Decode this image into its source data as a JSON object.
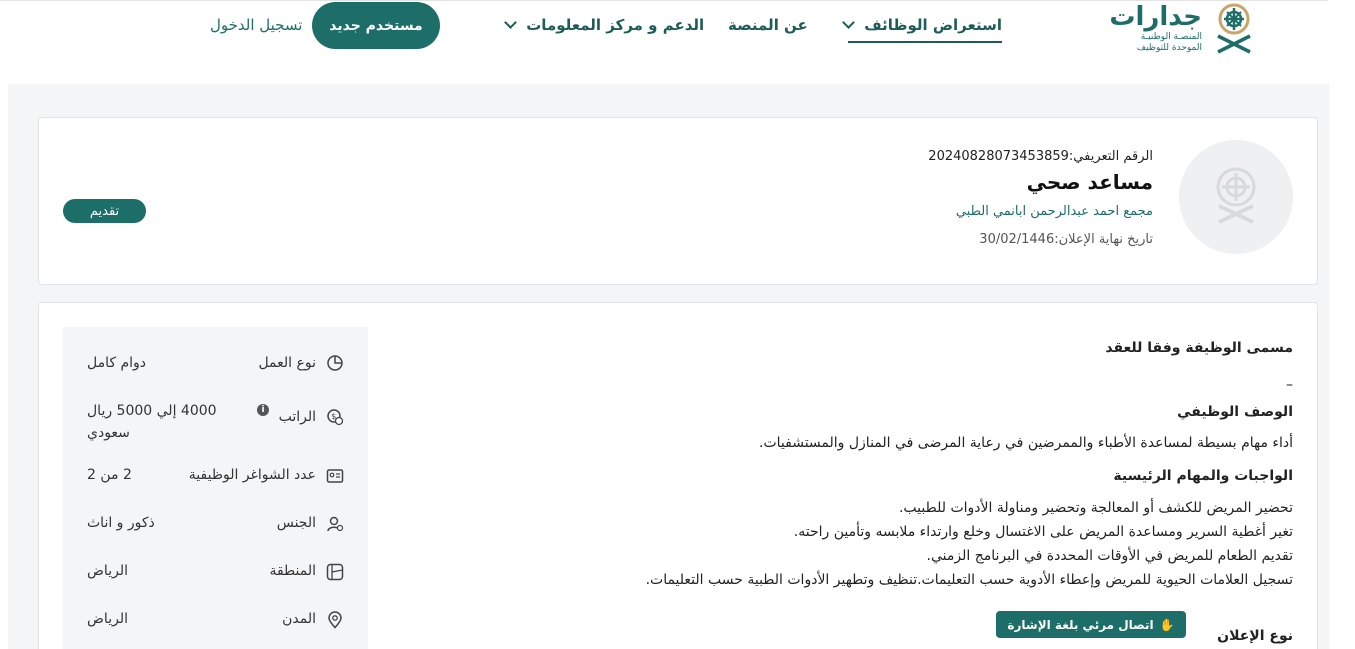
{
  "header": {
    "logo_word": "جدارات",
    "logo_sub_1": "المنصـة الوطنيـة",
    "logo_sub_2": "الموحدة للتوظيف",
    "nav": {
      "jobs": "استعراض الوظائف",
      "about": "عن المنصة",
      "support": "الدعم و مركز المعلومات"
    },
    "register_label": "مستخدم جديد",
    "login_label": "تسجيل الدخول"
  },
  "job": {
    "id_label": "الرقم التعريفي:",
    "id_value": "20240828073453859",
    "title": "مساعد صحي",
    "company": "مجمع احمد عبدالرحمن ابانمي الطبي",
    "deadline_label": "تاريخ نهاية الإعلان:",
    "deadline_value": "30/02/1446",
    "apply_label": "تقديم"
  },
  "details": {
    "work_type": {
      "label": "نوع العمل",
      "value": "دوام كامل",
      "icon": "pie-chart-icon"
    },
    "salary": {
      "label": "الراتب",
      "value": "4000 إلي 5000 ريال سعودي",
      "icon": "money-icon"
    },
    "vacancies": {
      "label": "عدد الشواغر الوظيفية",
      "value": "2  من 2",
      "icon": "id-card-icon"
    },
    "gender": {
      "label": "الجنس",
      "value": "ذكور و اناث",
      "icon": "person-icon"
    },
    "region": {
      "label": "المنطقة",
      "value": "الرياض",
      "icon": "map-icon"
    },
    "city": {
      "label": "المدن",
      "value": "الرياض",
      "icon": "location-pin-icon"
    }
  },
  "description": {
    "contract_title_heading": "مسمى الوظيفة وفقا للعقد",
    "contract_title_value": "–",
    "job_desc_heading": "الوصف الوظيفي",
    "job_desc_text": "أداء مهام بسيطة لمساعدة الأطباء والممرضين في رعاية المرضى في المنازل والمستشفيات.",
    "duties_heading": "الواجبات والمهام الرئيسية",
    "duties": [
      "تحضير المريض للكشف أو المعالجة وتحضير ومناولة الأدوات للطبيب.",
      "تغير أغطية السرير ومساعدة المريض على الاغتسال وخلع وارتداء ملابسه وتأمين راحته.",
      "تقديم الطعام للمريض في الأوقات المحددة في البرنامج الزمني.",
      "تسجيل العلامات الحيوية للمريض وإعطاء الأدوية حسب التعليمات.تنظيف وتطهير الأدوات الطبية حسب التعليمات."
    ],
    "ad_type_heading": "نوع الإعلان"
  },
  "sign_language_label": "اتصال مرئي بلغة الإشارة",
  "colors": {
    "brand": "#1d6e68",
    "band": "#f3f5f7"
  }
}
